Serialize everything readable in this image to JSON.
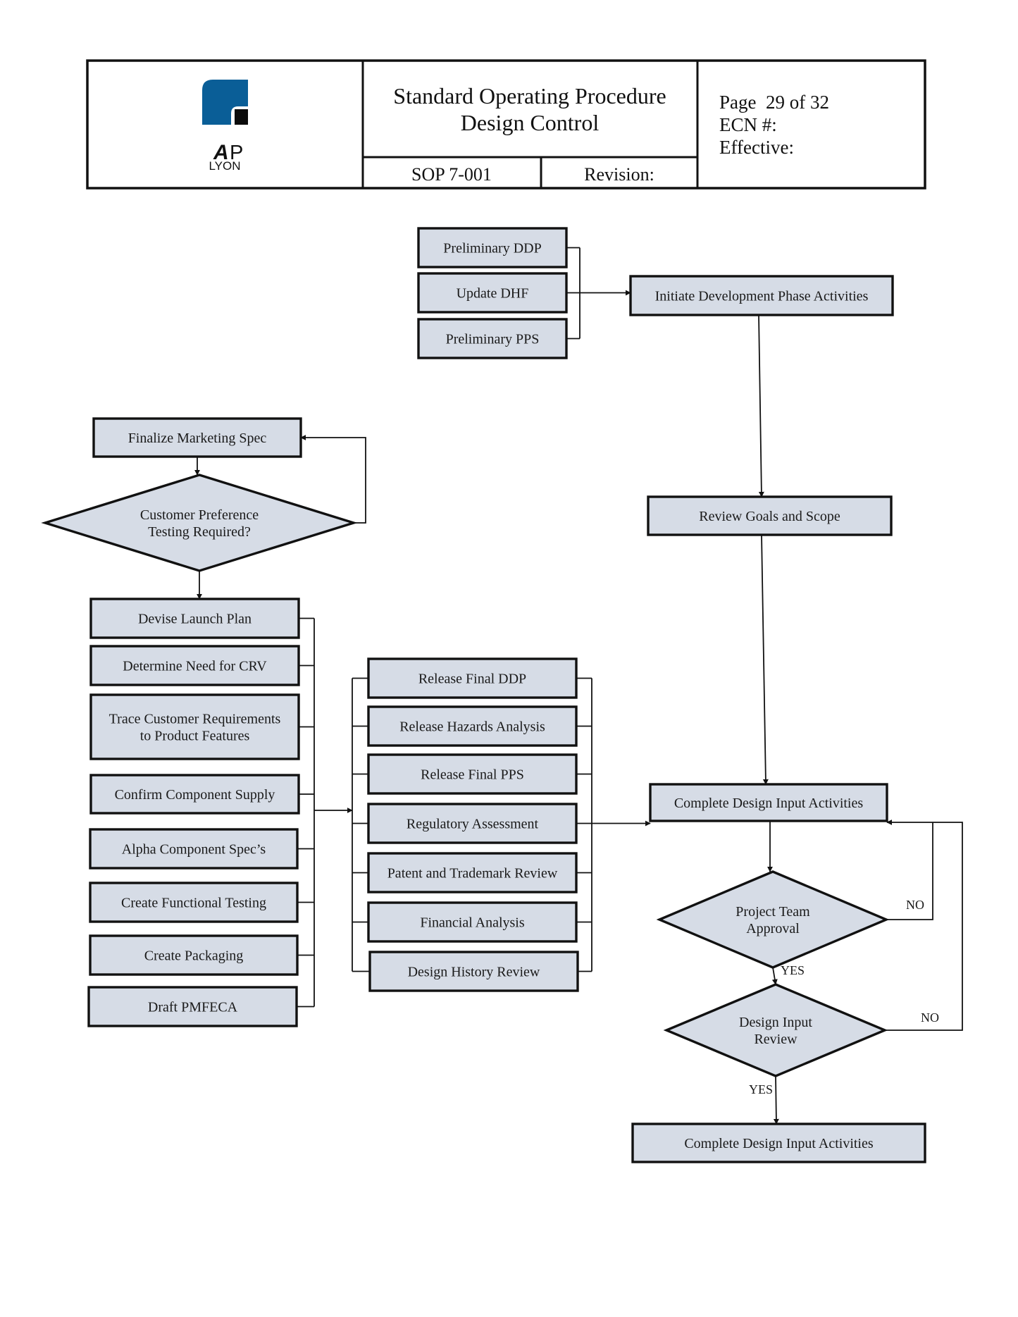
{
  "header": {
    "logo": {
      "brand_letters": [
        "A",
        "P"
      ],
      "brand_sub": "LYON",
      "colors": {
        "blue": "#0a5e97",
        "black": "#0b0b0b"
      }
    },
    "title_line1": "Standard Operating Procedure",
    "title_line2": "Design Control",
    "sop_number": "SOP 7-001",
    "revision_label": "Revision:",
    "page_info": "Page  29 of 32",
    "ecn_label": "ECN #:",
    "effective_label": "Effective:"
  },
  "colors": {
    "node_fill": "#d6dce6",
    "stroke": "#111111"
  },
  "flowchart": {
    "nodes": [
      {
        "id": "prelim-ddp",
        "type": "process",
        "lines": [
          "Preliminary DDP"
        ]
      },
      {
        "id": "update-dhf",
        "type": "process",
        "lines": [
          "Update DHF"
        ]
      },
      {
        "id": "prelim-pps",
        "type": "process",
        "lines": [
          "Preliminary PPS"
        ]
      },
      {
        "id": "initiate-dev",
        "type": "process",
        "lines": [
          "Initiate Development Phase Activities"
        ]
      },
      {
        "id": "review-goals",
        "type": "process",
        "lines": [
          "Review Goals and Scope"
        ]
      },
      {
        "id": "finalize-marketing",
        "type": "process",
        "lines": [
          "Finalize Marketing Spec"
        ]
      },
      {
        "id": "customer-pref",
        "type": "decision",
        "lines": [
          "Customer Preference",
          "Testing Required?"
        ]
      },
      {
        "id": "devise-launch",
        "type": "process",
        "lines": [
          "Devise Launch Plan"
        ]
      },
      {
        "id": "determine-crv",
        "type": "process",
        "lines": [
          "Determine Need for CRV"
        ]
      },
      {
        "id": "trace-reqs",
        "type": "process",
        "lines": [
          "Trace Customer Requirements",
          "to Product Features"
        ]
      },
      {
        "id": "confirm-supply",
        "type": "process",
        "lines": [
          "Confirm Component Supply"
        ]
      },
      {
        "id": "alpha-spec",
        "type": "process",
        "lines": [
          "Alpha Component Spec’s"
        ]
      },
      {
        "id": "functional-testing",
        "type": "process",
        "lines": [
          "Create Functional Testing"
        ]
      },
      {
        "id": "create-packaging",
        "type": "process",
        "lines": [
          "Create Packaging"
        ]
      },
      {
        "id": "draft-pmfeca",
        "type": "process",
        "lines": [
          "Draft PMFECA"
        ]
      },
      {
        "id": "release-ddp",
        "type": "process",
        "lines": [
          "Release Final DDP"
        ]
      },
      {
        "id": "release-hazards",
        "type": "process",
        "lines": [
          "Release Hazards Analysis"
        ]
      },
      {
        "id": "release-pps",
        "type": "process",
        "lines": [
          "Release Final PPS"
        ]
      },
      {
        "id": "regulatory",
        "type": "process",
        "lines": [
          "Regulatory Assessment"
        ]
      },
      {
        "id": "patent-trademark",
        "type": "process",
        "lines": [
          "Patent and Trademark Review"
        ]
      },
      {
        "id": "financial",
        "type": "process",
        "lines": [
          "Financial Analysis"
        ]
      },
      {
        "id": "design-history",
        "type": "process",
        "lines": [
          "Design History Review"
        ]
      },
      {
        "id": "complete-input-1",
        "type": "process",
        "lines": [
          "Complete Design Input Activities"
        ]
      },
      {
        "id": "team-approval",
        "type": "decision",
        "lines": [
          "Project Team",
          "Approval"
        ]
      },
      {
        "id": "input-review",
        "type": "decision",
        "lines": [
          "Design Input",
          "Review"
        ]
      },
      {
        "id": "complete-input-2",
        "type": "process",
        "lines": [
          "Complete Design Input Activities"
        ]
      }
    ],
    "edge_labels": {
      "approval_no": "NO",
      "approval_yes": "YES",
      "review_no": "NO",
      "review_yes": "YES"
    }
  }
}
